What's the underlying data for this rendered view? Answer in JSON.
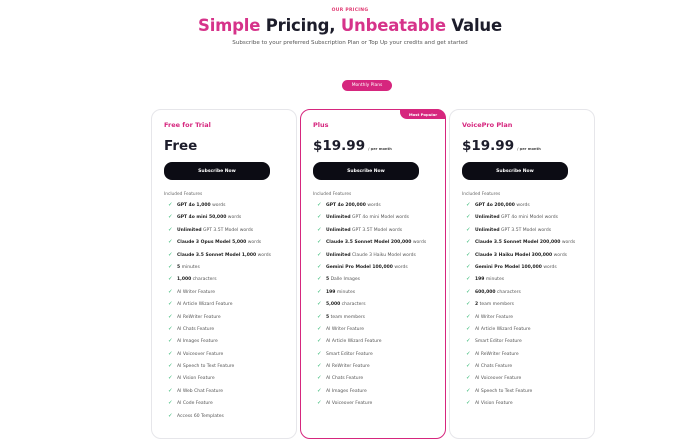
{
  "header": {
    "eyebrow": "OUR PRICING",
    "title_accent_1": "Simple",
    "title_mid": " Pricing, ",
    "title_accent_2": "Unbeatable",
    "title_end": " Value",
    "subtitle": "Subscribe to your preferred Subscription Plan or Top Up your credits and get started"
  },
  "toggle": {
    "label": "Monthly Plans"
  },
  "colors": {
    "accent": "#d6267e",
    "check": "#27b36a",
    "button": "#0c0c14"
  },
  "plans": [
    {
      "name": "Free for Trial",
      "price": "Free",
      "period": "",
      "badge": "",
      "button": "Subscribe Now",
      "included_label": "Included Features",
      "features": [
        {
          "bold": "GPT 4o 1,000",
          "text": " words"
        },
        {
          "bold": "GPT 4o mini 50,000",
          "text": " words"
        },
        {
          "bold": "Unlimited",
          "text": " GPT 3.5T Model words"
        },
        {
          "bold": "Claude 3 Opus Model 5,000",
          "text": " words"
        },
        {
          "bold": "Claude 3.5 Sonnet Model 1,000",
          "text": " words"
        },
        {
          "bold": "5",
          "text": " minutes"
        },
        {
          "bold": "1,000",
          "text": " characters"
        },
        {
          "bold": "",
          "text": "AI Writer Feature"
        },
        {
          "bold": "",
          "text": "AI Article Wizard Feature"
        },
        {
          "bold": "",
          "text": "AI ReWriter Feature"
        },
        {
          "bold": "",
          "text": "AI Chats Feature"
        },
        {
          "bold": "",
          "text": "AI Images Feature"
        },
        {
          "bold": "",
          "text": "AI Voiceover Feature"
        },
        {
          "bold": "",
          "text": "AI Speech to Text Feature"
        },
        {
          "bold": "",
          "text": "AI Vision Feature"
        },
        {
          "bold": "",
          "text": "AI Web Chat Feature"
        },
        {
          "bold": "",
          "text": "AI Code Feature"
        },
        {
          "bold": "",
          "text": "Access 60 Templates"
        }
      ]
    },
    {
      "name": "Plus",
      "price": "$19.99",
      "period": "/ per month",
      "badge": "Most Popular",
      "button": "Subscribe Now",
      "included_label": "Included Features",
      "features": [
        {
          "bold": "GPT 4o 200,000",
          "text": " words"
        },
        {
          "bold": "Unlimited",
          "text": " GPT 4o mini Model words"
        },
        {
          "bold": "Unlimited",
          "text": " GPT 3.5T Model words"
        },
        {
          "bold": "Claude 3.5 Sonnet Model 200,000",
          "text": " words"
        },
        {
          "bold": "Unlimited",
          "text": " Claude 3 Haiku Model words"
        },
        {
          "bold": "Gemini Pro Model 100,000",
          "text": " words"
        },
        {
          "bold": "5",
          "text": " Dalle Images"
        },
        {
          "bold": "199",
          "text": " minutes"
        },
        {
          "bold": "5,000",
          "text": " characters"
        },
        {
          "bold": "5",
          "text": " team members"
        },
        {
          "bold": "",
          "text": "AI Writer Feature"
        },
        {
          "bold": "",
          "text": "AI Article Wizard Feature"
        },
        {
          "bold": "",
          "text": "Smart Editor Feature"
        },
        {
          "bold": "",
          "text": "AI ReWriter Feature"
        },
        {
          "bold": "",
          "text": "AI Chats Feature"
        },
        {
          "bold": "",
          "text": "AI Images Feature"
        },
        {
          "bold": "",
          "text": "AI Voiceover Feature"
        }
      ]
    },
    {
      "name": "VoicePro Plan",
      "price": "$19.99",
      "period": "/ per month",
      "badge": "",
      "button": "Subscribe Now",
      "included_label": "Included Features",
      "features": [
        {
          "bold": "GPT 4o 200,000",
          "text": " words"
        },
        {
          "bold": "Unlimited",
          "text": " GPT 4o mini Model words"
        },
        {
          "bold": "Unlimited",
          "text": " GPT 3.5T Model words"
        },
        {
          "bold": "Claude 3.5 Sonnet Model 200,000",
          "text": " words"
        },
        {
          "bold": "Claude 3 Haiku Model 300,000",
          "text": " words"
        },
        {
          "bold": "Gemini Pro Model 100,000",
          "text": " words"
        },
        {
          "bold": "199",
          "text": " minutes"
        },
        {
          "bold": "600,000",
          "text": " characters"
        },
        {
          "bold": "2",
          "text": " team members"
        },
        {
          "bold": "",
          "text": "AI Writer Feature"
        },
        {
          "bold": "",
          "text": "AI Article Wizard Feature"
        },
        {
          "bold": "",
          "text": "Smart Editor Feature"
        },
        {
          "bold": "",
          "text": "AI ReWriter Feature"
        },
        {
          "bold": "",
          "text": "AI Chats Feature"
        },
        {
          "bold": "",
          "text": "AI Voiceover Feature"
        },
        {
          "bold": "",
          "text": "AI Speech to Text Feature"
        },
        {
          "bold": "",
          "text": "AI Vision Feature"
        }
      ]
    }
  ]
}
